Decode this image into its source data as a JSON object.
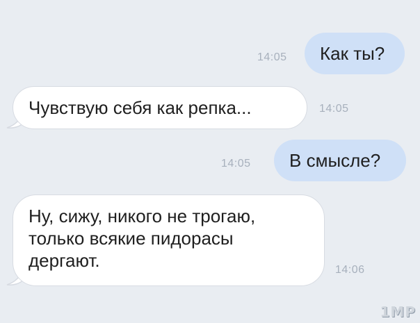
{
  "messages": [
    {
      "direction": "outgoing",
      "text": "Как ты?",
      "time": "14:05"
    },
    {
      "direction": "incoming",
      "text": "Чувствую себя как репка...",
      "time": "14:05"
    },
    {
      "direction": "outgoing",
      "text": "В смысле?",
      "time": "14:05"
    },
    {
      "direction": "incoming",
      "lines": [
        "Ну, сижу, никого не трогаю,",
        "только всякие пидорасы",
        "дергают."
      ],
      "time": "14:06"
    }
  ],
  "watermark": "1MP",
  "colors": {
    "background": "#e9edf2",
    "outgoing_bubble": "#cfe0f7",
    "incoming_bubble": "#ffffff",
    "timestamp": "#a7b0bc"
  }
}
